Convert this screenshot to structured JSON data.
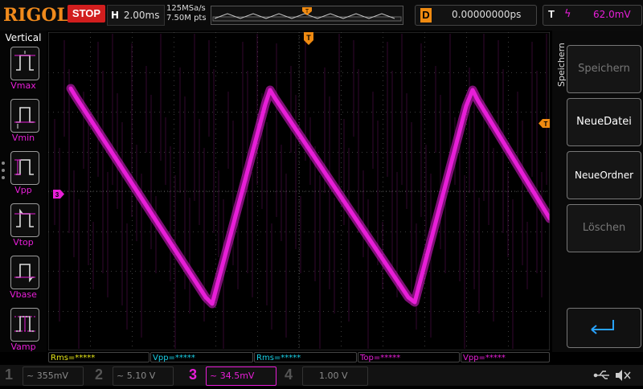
{
  "header": {
    "brand": "RIGOL",
    "run_state": "STOP",
    "timebase_label": "H",
    "timebase": "2.00ms",
    "sample_rate": "125MSa/s",
    "memory_depth": "7.50M pts",
    "delay_label": "D",
    "delay": "0.00000000ps",
    "trigger_label": "T",
    "trigger_slope": "ϟ",
    "trigger_level": "62.0mV",
    "trigger_position_marker": "T"
  },
  "left_menu": {
    "title": "Vertical",
    "items": [
      {
        "label": "Vmax"
      },
      {
        "label": "Vmin"
      },
      {
        "label": "Vpp"
      },
      {
        "label": "Vtop"
      },
      {
        "label": "Vbase"
      },
      {
        "label": "Vamp"
      }
    ]
  },
  "right_menu": {
    "title": "Speichern",
    "buttons": [
      {
        "label": "Speichern",
        "enabled": false
      },
      {
        "label": "NeueDatei",
        "enabled": true
      },
      {
        "label": "NeueOrdner",
        "enabled": true
      },
      {
        "label": "Löschen",
        "enabled": false
      }
    ],
    "back_icon": "return-arrow-icon"
  },
  "waveform": {
    "channel_marker": "3",
    "trigger_level_marker": "T",
    "color": "#e81ed8"
  },
  "measurements": [
    {
      "label": "Rms=*****",
      "color": "#e6e617"
    },
    {
      "label": "Vpp=*****",
      "color": "#19d0e6"
    },
    {
      "label": "Rms=*****",
      "color": "#19d0e6"
    },
    {
      "label": "Top=*****",
      "color": "#e81ed8"
    },
    {
      "label": "Vpp=*****",
      "color": "#e81ed8"
    }
  ],
  "channels": [
    {
      "num": "1",
      "value": "355mV",
      "coupling": "~",
      "color": "#7a7a7a",
      "active": false
    },
    {
      "num": "2",
      "value": "5.10 V",
      "coupling": "~",
      "color": "#7a7a7a",
      "active": false
    },
    {
      "num": "3",
      "value": "34.5mV",
      "coupling": "~",
      "color": "#e81ed8",
      "active": true
    },
    {
      "num": "4",
      "value": "1.00 V",
      "coupling": "",
      "color": "#7a7a7a",
      "active": false
    }
  ],
  "status_icons": [
    "usb-icon",
    "speaker-muted-icon"
  ],
  "colors": {
    "brand": "#f08a1c",
    "stop": "#d21e1e",
    "ch3": "#e81ed8",
    "delay_badge": "#ef8a11"
  }
}
